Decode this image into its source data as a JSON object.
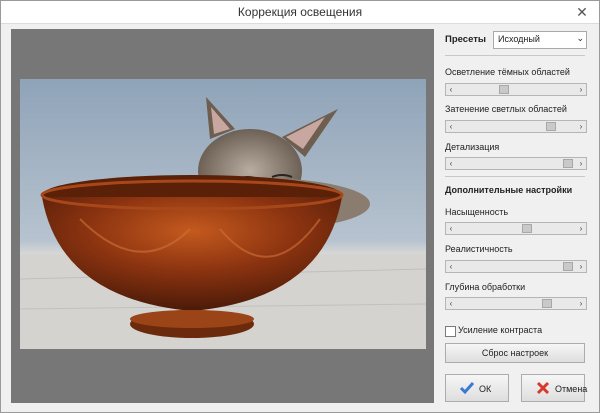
{
  "window": {
    "title": "Коррекция освещения",
    "close": "✕"
  },
  "presets": {
    "label": "Пресеты",
    "selected": "Исходный"
  },
  "sliders": [
    {
      "label": "Осветление тёмных областей",
      "value": 0.39
    },
    {
      "label": "Затенение светлых областей",
      "value": 0.82
    },
    {
      "label": "Детализация",
      "value": 0.97
    }
  ],
  "advanced": {
    "title": "Дополнительные настройки"
  },
  "advanced_sliders": [
    {
      "label": "Насыщенность",
      "value": 0.6
    },
    {
      "label": "Реалистичность",
      "value": 0.97
    },
    {
      "label": "Глубина обработки",
      "value": 0.78
    }
  ],
  "contrast": {
    "label": "Усиление контраста",
    "checked": false
  },
  "buttons": {
    "reset": "Сброс настроек",
    "ok": "ОК",
    "cancel": "Отмена"
  },
  "icons": {
    "ok": "checkmark-icon",
    "cancel": "red-x-icon"
  },
  "colors": {
    "preview_bg": "#777777",
    "ok_icon": "#3a78d6",
    "cancel_icon": "#d63a2a"
  }
}
